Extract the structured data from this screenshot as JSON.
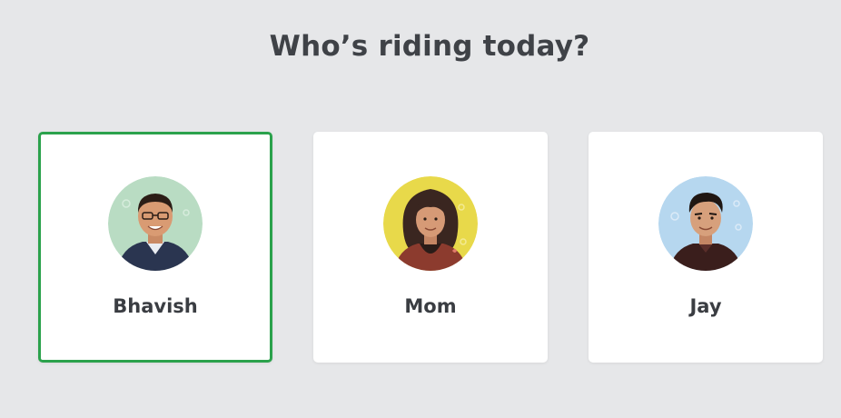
{
  "page": {
    "title": "Who’s riding today?"
  },
  "profiles": [
    {
      "name": "Bhavish",
      "selected": true,
      "avatar_icon": "man-glasses-avatar-icon",
      "avatar_bg": "#b9dcc3"
    },
    {
      "name": "Mom",
      "selected": false,
      "avatar_icon": "woman-curly-hair-avatar-icon",
      "avatar_bg": "#e8d94a"
    },
    {
      "name": "Jay",
      "selected": false,
      "avatar_icon": "young-man-avatar-icon",
      "avatar_bg": "#b6d7ef"
    }
  ],
  "colors": {
    "background": "#e6e7e9",
    "selected_border": "#2ba24c",
    "card": "#ffffff",
    "text": "#3f4247"
  }
}
